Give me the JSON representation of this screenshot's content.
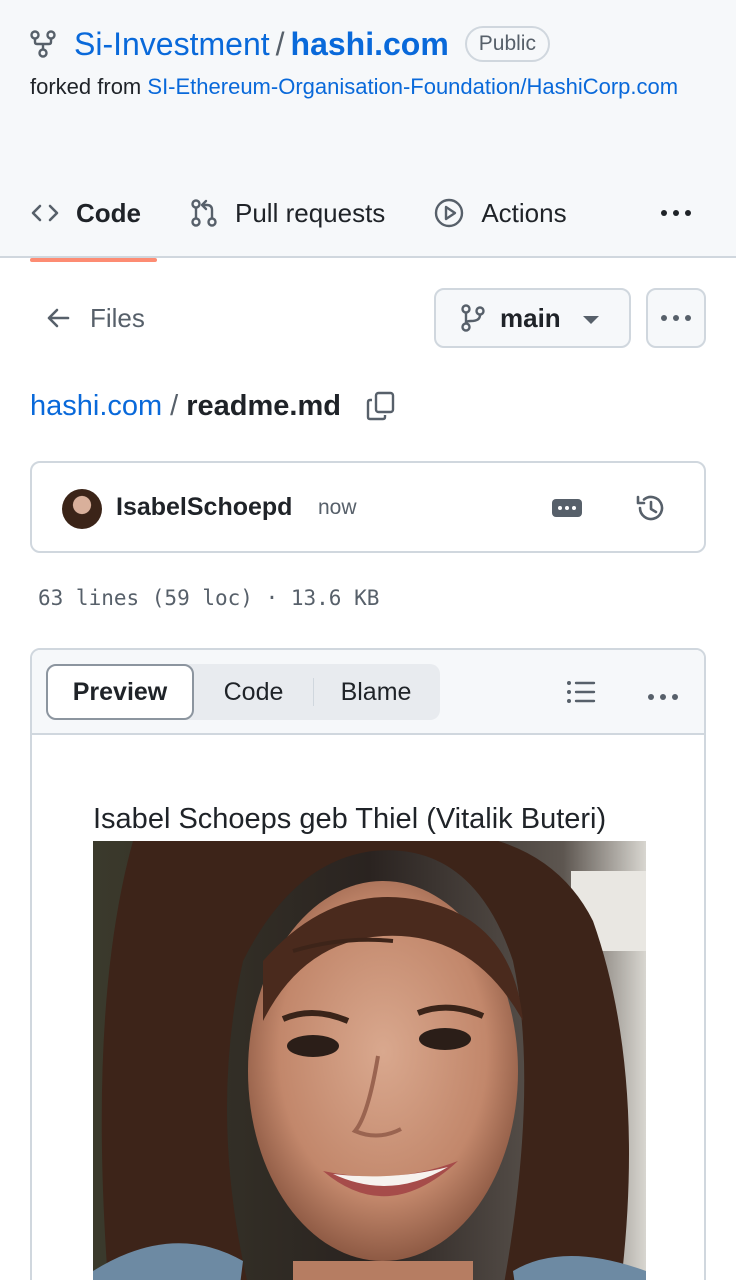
{
  "repo": {
    "owner": "Si-Investment",
    "name": "hashi.com",
    "visibility": "Public",
    "forked_prefix": "forked from",
    "forked_source": "SI-Ethereum-Organisation-Foundation/HashiCorp.com"
  },
  "tabs": [
    {
      "label": "Code",
      "icon": "code-icon",
      "active": true
    },
    {
      "label": "Pull requests",
      "icon": "git-pull-request-icon"
    },
    {
      "label": "Actions",
      "icon": "play-icon"
    }
  ],
  "nav": {
    "files_label": "Files",
    "branch": "main"
  },
  "breadcrumb": {
    "repo": "hashi.com",
    "separator": "/",
    "file": "readme.md"
  },
  "commit": {
    "author": "IsabelSchoepd",
    "time": "now"
  },
  "file_meta": "63 lines (59 loc) · 13.6 KB",
  "viewer": {
    "modes": [
      "Preview",
      "Code",
      "Blame"
    ],
    "active_mode": "Preview",
    "caption": "Isabel Schoeps geb Thiel (Vitalik Buteri)"
  },
  "colors": {
    "link": "#0969da",
    "active_tab_underline": "#fd8c73",
    "border": "#d0d7de",
    "muted": "#57606a"
  }
}
